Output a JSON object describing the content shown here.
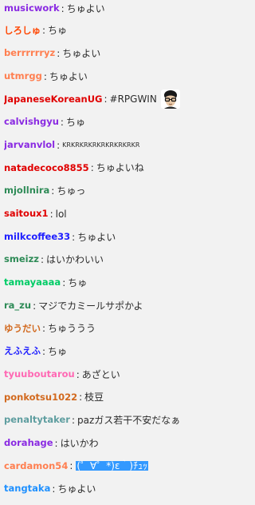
{
  "messages": [
    {
      "user": "musicwork",
      "color": "#8a2be2",
      "text": "ちゅよい"
    },
    {
      "user": "しろしゅ",
      "color": "#ff4500",
      "text": "ちゅ"
    },
    {
      "user": "berrrrrryz",
      "color": "#ff7f50",
      "text": "ちゅよい"
    },
    {
      "user": "utmrgg",
      "color": "#ff7f50",
      "text": "ちゅよい"
    },
    {
      "user": "JapaneseKoreanUG",
      "color": "#e00000",
      "text": "#RPGWIN",
      "emote": "glasses-face-emote"
    },
    {
      "user": "calvishgyu",
      "color": "#8a2be2",
      "text": "ちゅ"
    },
    {
      "user": "jarvanvlol",
      "color": "#8a2be2",
      "text": "KRKRKRKRKRKRKRKRKR",
      "small": true
    },
    {
      "user": "natadecoco8855",
      "color": "#e00000",
      "text": "ちゅよいね"
    },
    {
      "user": "mjollnira",
      "color": "#2e8b57",
      "text": "ちゅっ"
    },
    {
      "user": "saitoux1",
      "color": "#e00000",
      "text": "lol"
    },
    {
      "user": "milkcoffee33",
      "color": "#1f1fff",
      "text": "ちゅよい"
    },
    {
      "user": "smeizz",
      "color": "#2e8b57",
      "text": "はいかわいい"
    },
    {
      "user": "tamayaaaa",
      "color": "#00cc66",
      "text": "ちゅ"
    },
    {
      "user": "ra_zu",
      "color": "#2e8b57",
      "text": "マジでカミールサポかよ"
    },
    {
      "user": "ゆうだい",
      "color": "#d2691e",
      "text": "ちゅううう"
    },
    {
      "user": "えふえふ",
      "color": "#1f1fff",
      "text": "ちゅ"
    },
    {
      "user": "tyuuboutarou",
      "color": "#ff69b4",
      "text": "あざとい"
    },
    {
      "user": "ponkotsu1022",
      "color": "#d2691e",
      "text": "枝豆"
    },
    {
      "user": "penaltytaker",
      "color": "#5f9ea0",
      "text": "pazガス若干不安だなぁ"
    },
    {
      "user": "dorahage",
      "color": "#8a2be2",
      "text": "はいかわ"
    },
    {
      "user": "cardamon54",
      "color": "#ff7f50",
      "text": "(゜∀゜*)ε｀)ﾁｭｯ",
      "highlight": true
    },
    {
      "user": "tangtaka",
      "color": "#1e90ff",
      "text": "ちゅよい"
    }
  ],
  "separator": ":"
}
